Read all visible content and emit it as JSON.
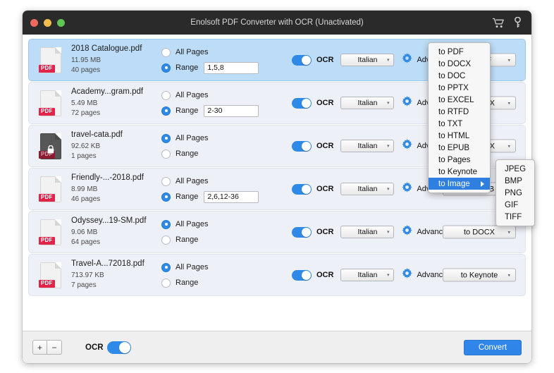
{
  "window": {
    "title": "Enolsoft PDF Converter with OCR (Unactivated)",
    "traffic_lights": [
      "close-red",
      "minimize-yellow",
      "maximize-green"
    ],
    "title_icons": [
      "cart-icon",
      "key-icon"
    ]
  },
  "colors": {
    "accent_blue": "#2e8ae6",
    "menu_highlight": "#2f7fe0",
    "selected_row": "#bcdcf7",
    "row_background": "#eef0f7",
    "pdf_badge_red": "#e1254a",
    "titlebar": "#2a2a2a",
    "convert_button": "#2f86e8"
  },
  "files": [
    {
      "name": "2018 Catalogue.pdf",
      "size": "11.95 MB",
      "pages": "40 pages",
      "icon": "pdf-file-icon",
      "locked": false,
      "selected": true,
      "all_pages_label": "All Pages",
      "range_label": "Range",
      "page_mode": "range",
      "range_value": "1,5,8",
      "ocr_label": "OCR",
      "ocr_on": true,
      "language": "Italian",
      "advanced_label": "Advanced Settings",
      "output_format": "to PDF"
    },
    {
      "name": "Academy...gram.pdf",
      "size": "5.49 MB",
      "pages": "72 pages",
      "icon": "pdf-file-icon",
      "locked": false,
      "selected": false,
      "all_pages_label": "All Pages",
      "range_label": "Range",
      "page_mode": "range",
      "range_value": "2-30",
      "ocr_label": "OCR",
      "ocr_on": true,
      "language": "Italian",
      "advanced_label": "Advanced Settings",
      "output_format": "to DOCX"
    },
    {
      "name": "travel-cata.pdf",
      "size": "92.62 KB",
      "pages": "1 pages",
      "icon": "pdf-file-locked-icon",
      "locked": true,
      "selected": false,
      "all_pages_label": "All Pages",
      "range_label": "Range",
      "page_mode": "all",
      "range_value": "",
      "ocr_label": "OCR",
      "ocr_on": true,
      "language": "Italian",
      "advanced_label": "Advanced Settings",
      "output_format": "to DOCX"
    },
    {
      "name": "Friendly-...-2018.pdf",
      "size": "8.99 MB",
      "pages": "46 pages",
      "icon": "pdf-file-icon",
      "locked": false,
      "selected": false,
      "all_pages_label": "All Pages",
      "range_label": "Range",
      "page_mode": "range",
      "range_value": "2,6,12-36",
      "ocr_label": "OCR",
      "ocr_on": true,
      "language": "Italian",
      "advanced_label": "Advanced Settings",
      "output_format": "to EPUB"
    },
    {
      "name": "Odyssey...19-SM.pdf",
      "size": "9.06 MB",
      "pages": "64 pages",
      "icon": "pdf-file-icon",
      "locked": false,
      "selected": false,
      "all_pages_label": "All Pages",
      "range_label": "Range",
      "page_mode": "all",
      "range_value": "",
      "ocr_label": "OCR",
      "ocr_on": true,
      "language": "Italian",
      "advanced_label": "Advanced Settings",
      "output_format": "to DOCX"
    },
    {
      "name": "Travel-A...72018.pdf",
      "size": "713.97 KB",
      "pages": "7 pages",
      "icon": "pdf-file-icon",
      "locked": false,
      "selected": false,
      "all_pages_label": "All Pages",
      "range_label": "Range",
      "page_mode": "all",
      "range_value": "",
      "ocr_label": "OCR",
      "ocr_on": true,
      "language": "Italian",
      "advanced_label": "Advanced Settings",
      "output_format": "to Keynote"
    }
  ],
  "format_menu": {
    "items": [
      {
        "label": "to PDF",
        "active": false,
        "has_submenu": false
      },
      {
        "label": "to DOCX",
        "active": false,
        "has_submenu": false
      },
      {
        "label": "to DOC",
        "active": false,
        "has_submenu": false
      },
      {
        "label": "to PPTX",
        "active": false,
        "has_submenu": false
      },
      {
        "label": "to EXCEL",
        "active": false,
        "has_submenu": false
      },
      {
        "label": "to RTFD",
        "active": false,
        "has_submenu": false
      },
      {
        "label": "to TXT",
        "active": false,
        "has_submenu": false
      },
      {
        "label": "to HTML",
        "active": false,
        "has_submenu": false
      },
      {
        "label": "to EPUB",
        "active": false,
        "has_submenu": false
      },
      {
        "label": "to Pages",
        "active": false,
        "has_submenu": false
      },
      {
        "label": "to Keynote",
        "active": false,
        "has_submenu": false
      },
      {
        "label": "to Image",
        "active": true,
        "has_submenu": true
      }
    ],
    "submenu": {
      "items": [
        {
          "label": "JPEG"
        },
        {
          "label": "BMP"
        },
        {
          "label": "PNG"
        },
        {
          "label": "GIF"
        },
        {
          "label": "TIFF"
        }
      ]
    }
  },
  "bottom_bar": {
    "add_label": "+",
    "remove_label": "−",
    "ocr_label": "OCR",
    "ocr_on": true,
    "convert_label": "Convert"
  }
}
